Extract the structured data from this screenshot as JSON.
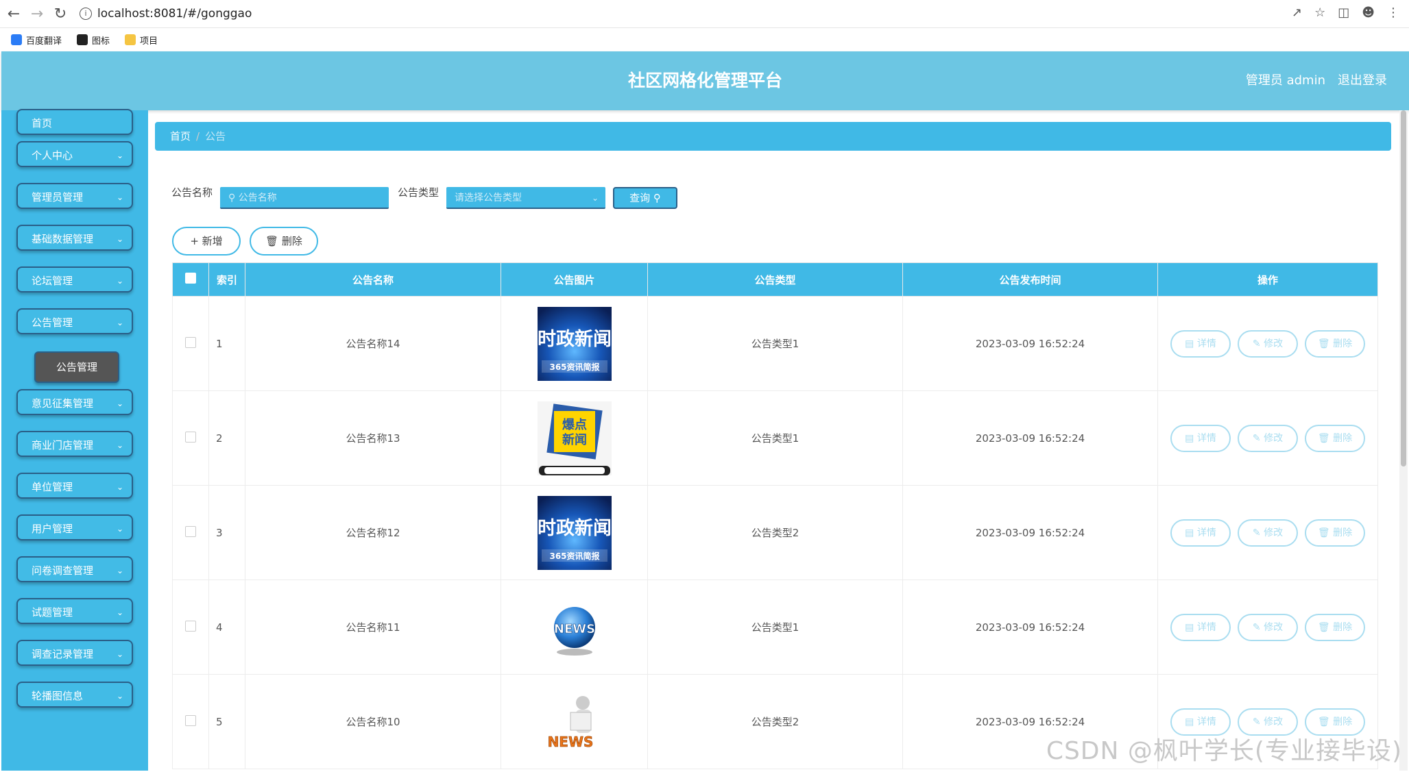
{
  "browser": {
    "url": "localhost:8081/#/gonggao",
    "bookmarks": [
      {
        "label": "百度翻译",
        "color": "#2b7cf6"
      },
      {
        "label": "图标",
        "color": "#222222"
      },
      {
        "label": "项目",
        "color": "#f5c542"
      }
    ]
  },
  "header": {
    "title": "社区网格化管理平台",
    "admin_label": "管理员 admin",
    "logout_label": "退出登录"
  },
  "sidebar": {
    "items": [
      {
        "label": "首页",
        "chevron": false
      },
      {
        "label": "个人中心",
        "chevron": true
      },
      {
        "label": "管理员管理",
        "chevron": true
      },
      {
        "label": "基础数据管理",
        "chevron": true
      },
      {
        "label": "论坛管理",
        "chevron": true
      },
      {
        "label": "公告管理",
        "chevron": true
      },
      {
        "label": "意见征集管理",
        "chevron": true
      },
      {
        "label": "商业门店管理",
        "chevron": true
      },
      {
        "label": "单位管理",
        "chevron": true
      },
      {
        "label": "用户管理",
        "chevron": true
      },
      {
        "label": "问卷调查管理",
        "chevron": true
      },
      {
        "label": "试题管理",
        "chevron": true
      },
      {
        "label": "调查记录管理",
        "chevron": true
      },
      {
        "label": "轮播图信息",
        "chevron": true
      }
    ],
    "submenu_label": "公告管理"
  },
  "breadcrumb": {
    "home": "首页",
    "separator": "/",
    "current": "公告"
  },
  "search": {
    "name_label": "公告名称",
    "name_placeholder": "公告名称",
    "type_label": "公告类型",
    "type_placeholder": "请选择公告类型",
    "query_label": "查询"
  },
  "actions": {
    "add_label": "新增",
    "delete_label": "删除"
  },
  "table": {
    "headers": [
      "索引",
      "公告名称",
      "公告图片",
      "公告类型",
      "公告发布时间",
      "操作"
    ],
    "rows": [
      {
        "index": "1",
        "name": "公告名称14",
        "image": "shizheng-news",
        "type": "公告类型1",
        "time": "2023-03-09 16:52:24"
      },
      {
        "index": "2",
        "name": "公告名称13",
        "image": "baodian-news",
        "type": "公告类型1",
        "time": "2023-03-09 16:52:24"
      },
      {
        "index": "3",
        "name": "公告名称12",
        "image": "shizheng-news",
        "type": "公告类型2",
        "time": "2023-03-09 16:52:24"
      },
      {
        "index": "4",
        "name": "公告名称11",
        "image": "news-globe",
        "type": "公告类型1",
        "time": "2023-03-09 16:52:24"
      },
      {
        "index": "5",
        "name": "公告名称10",
        "image": "news-reader",
        "type": "公告类型2",
        "time": "2023-03-09 16:52:24"
      }
    ],
    "op_labels": {
      "detail": "详情",
      "edit": "修改",
      "delete": "删除"
    }
  },
  "images": {
    "shizheng": {
      "line1": "时政新闻",
      "line2": "365资讯简报"
    },
    "baodian": {
      "line1": "爆点",
      "line2": "新闻"
    },
    "globe": "NEWS",
    "reader": "NEWS"
  },
  "watermark": "CSDN @枫叶学长(专业接毕设)",
  "colors": {
    "primary": "#40b9e6",
    "header": "#6cc6e3",
    "border_dark": "#2a5f88"
  }
}
